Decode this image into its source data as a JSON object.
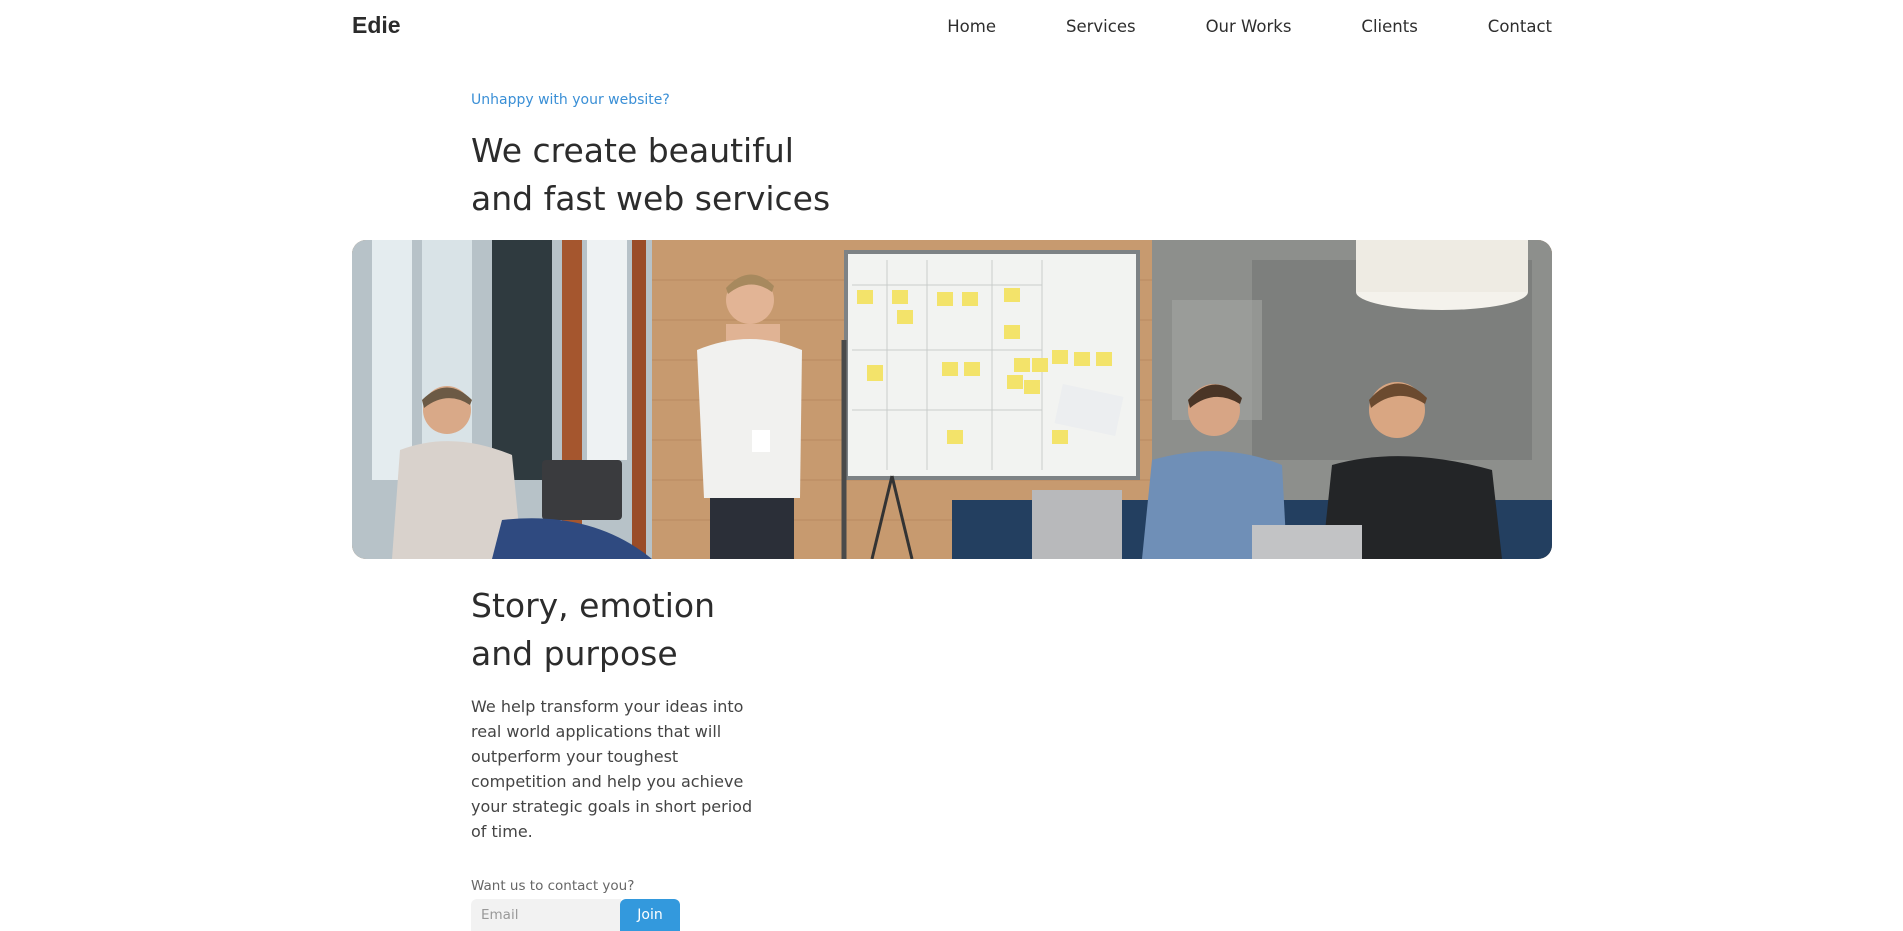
{
  "brand": {
    "name": "Edie"
  },
  "nav": {
    "items": [
      {
        "label": "Home"
      },
      {
        "label": "Services"
      },
      {
        "label": "Our Works"
      },
      {
        "label": "Clients"
      },
      {
        "label": "Contact"
      }
    ]
  },
  "hero": {
    "eyebrow": "Unhappy with your website?",
    "title_line1": "We create beautiful",
    "title_line2": "and fast web services",
    "image_subject": "team-meeting-whiteboard-photo"
  },
  "story": {
    "title_line1": "Story, emotion",
    "title_line2": "and purpose",
    "text": "We help transform your ideas into real world applications that will outperform your toughest competition and help you achieve your strategic goals in short period of time."
  },
  "contact": {
    "label": "Want us to contact you?",
    "email_placeholder": "Email",
    "join_label": "Join"
  },
  "colors": {
    "accent": "#3399dd",
    "eyebrow": "#3a8fd6",
    "heading": "#2c2c2c"
  }
}
